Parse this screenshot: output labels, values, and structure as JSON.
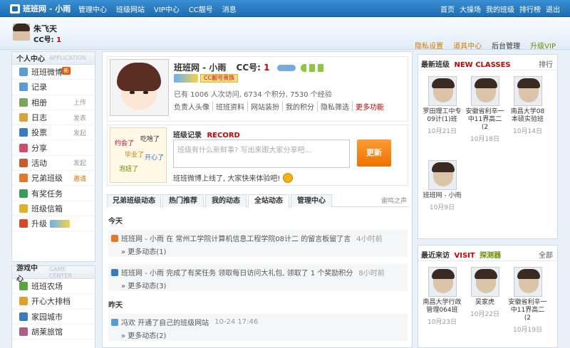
{
  "topbar": {
    "logo": "班班网 - 小雨",
    "nav": [
      "管理中心",
      "班级网站",
      "VIP中心",
      "CC靓号",
      "消息"
    ],
    "right": [
      "首页",
      "大操场",
      "我的班级",
      "排行榜",
      "退出"
    ]
  },
  "header": {
    "name": "朱飞天",
    "cc_label": "CC号:",
    "cc_value": "1",
    "links": [
      "隐私设置",
      "道具中心",
      "后台管理",
      "升级VIP"
    ]
  },
  "sidebar": {
    "title": "个人中心",
    "title_en": "APPLICATION",
    "items": [
      {
        "label": "班班微博",
        "action": "",
        "badge": "新",
        "icon_color": "#5b9bd5"
      },
      {
        "label": "记录",
        "action": "",
        "badge": "",
        "icon_color": "#5b9bd5"
      },
      {
        "label": "相册",
        "action": "上传",
        "badge": "",
        "icon_color": "#7aa55a"
      },
      {
        "label": "日志",
        "action": "发表",
        "badge": "",
        "icon_color": "#d9a33b"
      },
      {
        "label": "投票",
        "action": "发起",
        "badge": "",
        "icon_color": "#3b7bbf"
      },
      {
        "label": "分享",
        "action": "",
        "badge": "",
        "icon_color": "#d04a6a"
      },
      {
        "label": "活动",
        "action": "发起",
        "badge": "",
        "icon_color": "#c75c2a"
      },
      {
        "label": "兄弟班级",
        "action": "邀请",
        "badge": "",
        "icon_color": "#e07a2a"
      },
      {
        "label": "有奖任务",
        "action": "",
        "badge": "",
        "icon_color": "#3a9b5a"
      },
      {
        "label": "班级信箱",
        "action": "",
        "badge": "",
        "icon_color": "#e0b02a"
      },
      {
        "label": "升级",
        "action": "",
        "badge": "",
        "icon_color": "#d9482a"
      }
    ]
  },
  "games": {
    "title": "游戏中心",
    "title_en": "GAME CENTER",
    "items": [
      {
        "label": "班班农场",
        "icon_color": "#5aa53a"
      },
      {
        "label": "开心大排档",
        "icon_color": "#e0a02a"
      },
      {
        "label": "家园城市",
        "icon_color": "#3a7bbf"
      },
      {
        "label": "胡莱旅馆",
        "icon_color": "#b05a8a"
      }
    ]
  },
  "profile": {
    "site": "班班网 - 小雨",
    "cc_label": "CC号:",
    "cc_value": "1",
    "badge_text": "CC靓号贵族",
    "stats": "已有 1006 人次访问, 6734 个积分, 7530 个经验",
    "links": [
      "负责人头像",
      "班班资料",
      "网站装扮",
      "我的积分",
      "隐私筛选",
      "更多功能"
    ]
  },
  "record": {
    "title": "班级记录",
    "title_en": "RECORD",
    "placeholder": "班级有什么新鲜事? 写出来跟大家分享吧...",
    "button": "更新",
    "tip": "班班微博上线了, 大家快来体验吧!",
    "doodle": [
      "约会了",
      "吃啥了",
      "毕业了",
      "开心了",
      "泡妞了"
    ]
  },
  "tabs": {
    "items": [
      "兄弟班级动态",
      "热门推荐",
      "我的动态",
      "全站动态",
      "管理中心"
    ],
    "active": "全站动态",
    "right": "雷鸣之声"
  },
  "feed": [
    {
      "day": "今天",
      "items": [
        {
          "text": "班班网 - 小雨 在 常州工学院计算机信息工程学院08计二 的留言板留了言",
          "time": "4小时前",
          "more": "» 更多动态(1)",
          "icon_color": "#e07a2a"
        },
        {
          "text": "班班网 - 小雨 完成了有奖任务 领取每日访问大礼包, 领取了 1 个奖励积分",
          "time": "8小时前",
          "more": "» 更多动态(3)",
          "icon_color": "#3a7bbf"
        }
      ]
    },
    {
      "day": "昨天",
      "items": [
        {
          "text": "冯欢 开通了自己的班级网站",
          "time": "10-24 17:46",
          "more": "» 更多动态(2)",
          "icon_color": "#5b9bd5"
        }
      ]
    }
  ],
  "new_classes": {
    "title": "最新班级",
    "title_en": "NEW CLASSES",
    "more": "排行",
    "items": [
      {
        "name": "罗田理工中专09计(1)班",
        "date": "10月21日"
      },
      {
        "name": "安徽省利辛一中11界高二(2",
        "date": "10月18日"
      },
      {
        "name": "南昌大学08本硕实验班",
        "date": "10月14日"
      },
      {
        "name": "班班网 - 小雨",
        "date": "10月9日"
      }
    ]
  },
  "recent_visits": {
    "title": "最近来访",
    "title_en": "VISIT",
    "title_en2": "探测器",
    "more": "全部",
    "items": [
      {
        "name": "南昌大学行政管理064班",
        "date": "10月23日"
      },
      {
        "name": "吴家虎",
        "date": "10月22日"
      },
      {
        "name": "安徽省利辛一中11界高二(2",
        "date": "10月19日"
      }
    ]
  }
}
